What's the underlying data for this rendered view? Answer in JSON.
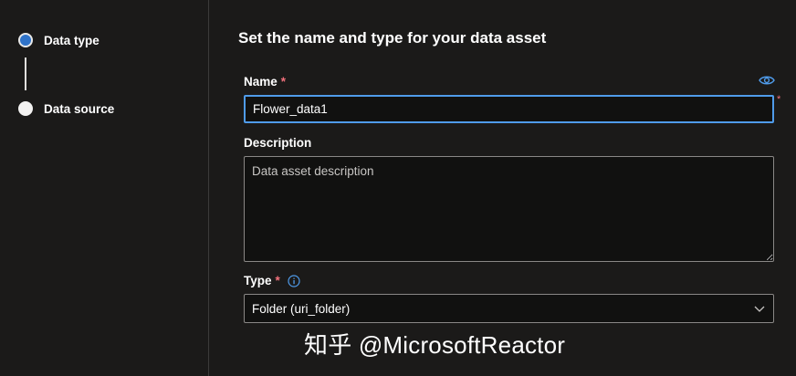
{
  "stepper": {
    "steps": [
      {
        "label": "Data type",
        "state": "active"
      },
      {
        "label": "Data source",
        "state": "pending"
      }
    ]
  },
  "main": {
    "title": "Set the name and type for your data asset",
    "name_field": {
      "label": "Name",
      "required_mark": "*",
      "value": "Flower_data1",
      "reveal_icon": "eye-icon"
    },
    "outside_required_mark": "*",
    "description_field": {
      "label": "Description",
      "placeholder": "Data asset description",
      "value": ""
    },
    "type_field": {
      "label": "Type",
      "required_mark": "*",
      "info_icon": "info-icon",
      "selected": "Folder (uri_folder)",
      "dropdown_icon": "chevron-down-icon"
    }
  },
  "watermark": {
    "text": "知乎 @MicrosoftReactor"
  },
  "colors": {
    "background": "#1b1a19",
    "input_background": "#111110",
    "focus_border": "#4f9bea",
    "required": "#f1707b",
    "active_step": "#2f73c9"
  }
}
